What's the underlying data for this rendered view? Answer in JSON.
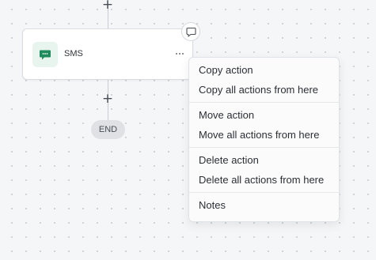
{
  "canvas": {
    "add_top": "+",
    "add_bottom": "+"
  },
  "node": {
    "label": "SMS",
    "icon": "sms-chat-icon",
    "accent": "#1f8a5b",
    "icon_bg": "#e7f5ee"
  },
  "end": {
    "label": "END"
  },
  "menu": {
    "groups": [
      {
        "items": [
          {
            "label": "Copy action"
          },
          {
            "label": "Copy all actions from here"
          }
        ]
      },
      {
        "items": [
          {
            "label": "Move action"
          },
          {
            "label": "Move all actions from here"
          }
        ]
      },
      {
        "items": [
          {
            "label": "Delete action"
          },
          {
            "label": "Delete all actions from here"
          }
        ]
      },
      {
        "items": [
          {
            "label": "Notes"
          }
        ]
      }
    ]
  }
}
